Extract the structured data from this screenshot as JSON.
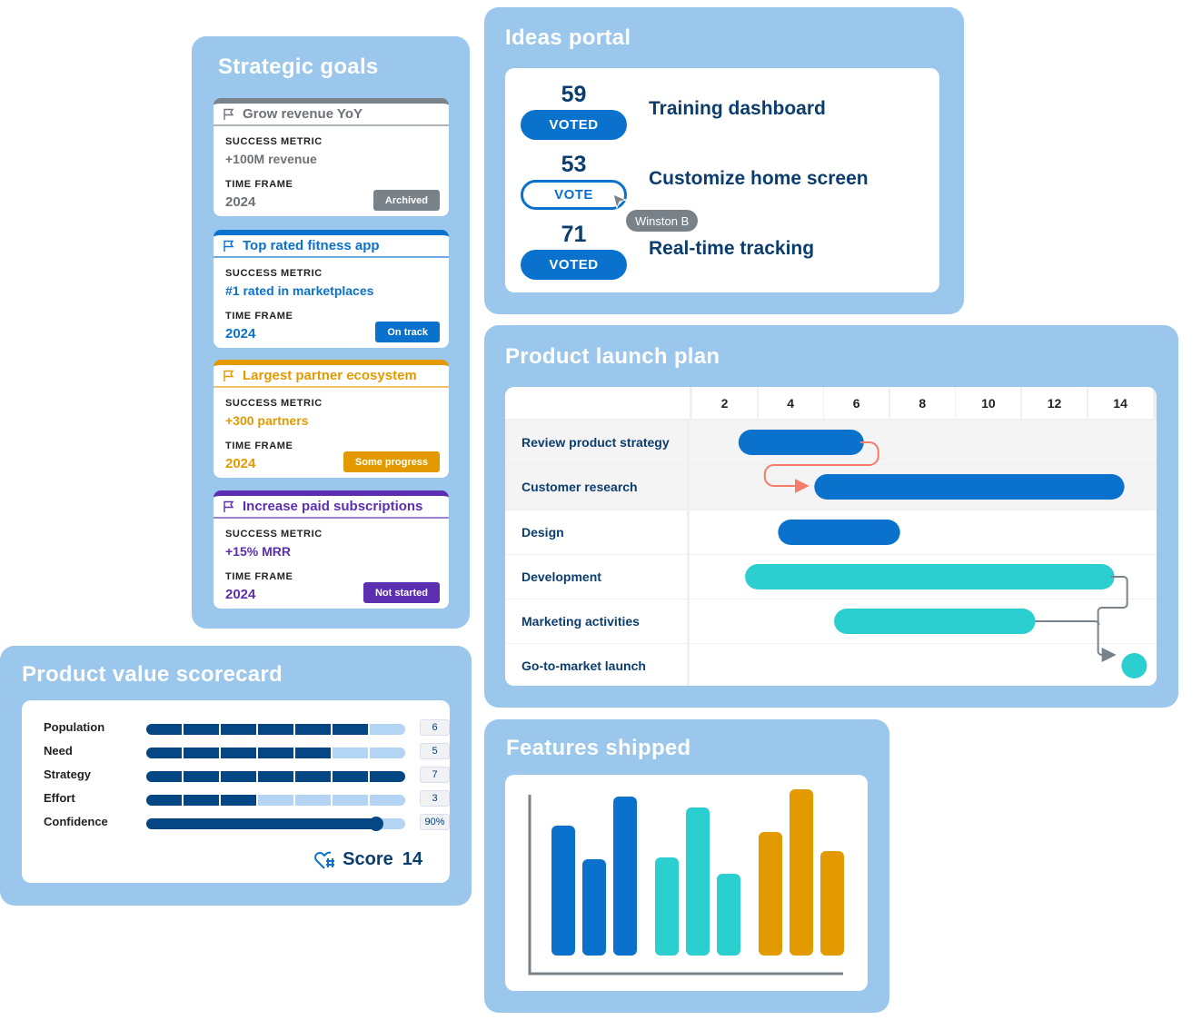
{
  "strategic_goals": {
    "title": "Strategic goals",
    "metric_label": "SUCCESS METRIC",
    "timeframe_label": "TIME FRAME",
    "goals": [
      {
        "name": "Grow revenue YoY",
        "metric": "+100M revenue",
        "timeframe": "2024",
        "status": "Archived",
        "color": "#7a8289",
        "text_color": "#6d7278"
      },
      {
        "name": "Top rated fitness app",
        "metric": "#1 rated in marketplaces",
        "timeframe": "2024",
        "status": "On track",
        "color": "#0a72cc",
        "text_color": "#0a72cc"
      },
      {
        "name": "Largest partner ecosystem",
        "metric": "+300 partners",
        "timeframe": "2024",
        "status": "Some progress",
        "color": "#e39a00",
        "text_color": "#e39a00"
      },
      {
        "name": "Increase paid subscriptions",
        "metric": "+15% MRR",
        "timeframe": "2024",
        "status": "Not started",
        "color": "#5b2fb0",
        "text_color": "#5b2fb0"
      }
    ]
  },
  "ideas_portal": {
    "title": "Ideas portal",
    "ideas": [
      {
        "votes": "59",
        "button": "VOTED",
        "voted": true,
        "title": "Training dashboard"
      },
      {
        "votes": "53",
        "button": "VOTE",
        "voted": false,
        "title": "Customize home screen"
      },
      {
        "votes": "71",
        "button": "VOTED",
        "voted": true,
        "title": "Real-time tracking"
      }
    ],
    "cursor_tooltip": "Winston B"
  },
  "launch_plan": {
    "title": "Product launch plan",
    "ticks": [
      "2",
      "4",
      "6",
      "8",
      "10",
      "12",
      "14"
    ],
    "tasks": [
      {
        "name": "Review product strategy",
        "start": 2.4,
        "end": 6.2,
        "color": "#0a72cc"
      },
      {
        "name": "Customer research",
        "start": 4.7,
        "end": 14.1,
        "color": "#0a72cc"
      },
      {
        "name": "Design",
        "start": 3.6,
        "end": 7.3,
        "color": "#0a72cc"
      },
      {
        "name": "Development",
        "start": 2.6,
        "end": 13.8,
        "color": "#2ccfcf"
      },
      {
        "name": "Marketing activities",
        "start": 5.3,
        "end": 11.4,
        "color": "#2ccfcf"
      },
      {
        "name": "Go-to-market launch",
        "milestone": 14.4,
        "color": "#2ccfcf"
      }
    ],
    "dependency_colors": {
      "critical": "#f47c6b",
      "normal": "#7a8289"
    }
  },
  "scorecard": {
    "title": "Product value scorecard",
    "max_segments": 7,
    "rows": [
      {
        "label": "Population",
        "value": 6,
        "display": "6"
      },
      {
        "label": "Need",
        "value": 5,
        "display": "5"
      },
      {
        "label": "Strategy",
        "value": 7,
        "display": "7"
      },
      {
        "label": "Effort",
        "value": 3,
        "display": "3"
      }
    ],
    "confidence": {
      "label": "Confidence",
      "percent": 90,
      "display": "90%"
    },
    "score_label": "Score",
    "score_value": "14"
  },
  "features_shipped": {
    "title": "Features shipped",
    "chart_data": {
      "type": "bar",
      "series": [
        {
          "color": "#0a72cc",
          "values": [
            143,
            106,
            175
          ]
        },
        {
          "color": "#2ccfcf",
          "values": [
            108,
            163,
            90
          ]
        },
        {
          "color": "#e39a00",
          "values": [
            136,
            183,
            115
          ]
        }
      ],
      "ylim": [
        0,
        190
      ],
      "grid": false
    }
  }
}
